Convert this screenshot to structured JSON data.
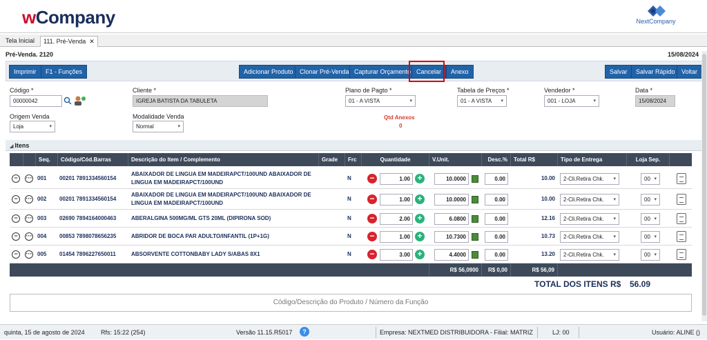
{
  "header": {
    "brand_w": "w",
    "brand_rest": "Company",
    "partner": "NextCompany"
  },
  "tabs": [
    {
      "label": "Tela Inicial"
    },
    {
      "label": "111. Pré-Venda",
      "close": "✕"
    }
  ],
  "page": {
    "title": "Pré-Venda. 2120",
    "date": "15/08/2024"
  },
  "toolbar": {
    "imprimir": "Imprimir",
    "f1": "F1 - Funções",
    "adicionar": "Adicionar Produto",
    "clonar": "Clonar Pré-Venda",
    "capturar": "Capturar Orçamento",
    "cancelar": "Cancelar",
    "anexo": "Anexo",
    "salvar": "Salvar",
    "salvar_rapido": "Salvar Rápido",
    "voltar": "Voltar"
  },
  "form": {
    "codigo_label": "Código *",
    "codigo": "00000042",
    "cliente_label": "Cliente *",
    "cliente": "IGREJA BATISTA DA TABULETA",
    "plano_label": "Plano de Pagto *",
    "plano": "01 - A VISTA",
    "tabela_label": "Tabela de Preços *",
    "tabela": "01 - A VISTA",
    "vendedor_label": "Vendedor *",
    "vendedor": "001 - LOJA",
    "data_label": "Data *",
    "data": "15/08/2024",
    "origem_label": "Origem Venda",
    "origem": "Loja",
    "modalidade_label": "Modalidade Venda",
    "modalidade": "Normal",
    "qtd_anexos_label": "Qtd Anexos",
    "qtd_anexos": "0"
  },
  "items_section": {
    "label": "Itens"
  },
  "columns": {
    "seq": "Seq.",
    "codigo": "Código/Cód.Barras",
    "descricao": "Descrição do Item / Complemento",
    "grade": "Grade",
    "frc": "Frc",
    "quantidade": "Quantidade",
    "vunit": "V.Unit.",
    "desc": "Desc.%",
    "total": "Total R$",
    "entrega": "Tipo de Entrega",
    "loja": "Loja Sep."
  },
  "rows": [
    {
      "seq": "001",
      "codigo": "00201 7891334560154",
      "desc_line1": "ABAIXADOR DE LINGUA EM MADEIRAPCT/100UND ABAIXADOR DE",
      "desc_line2": "LINGUA EM MADEIRAPCT/100UND",
      "frc": "N",
      "qty": "1.00",
      "vunit": "10.0000",
      "descp": "0.00",
      "total": "10.00",
      "entrega": "2-Cli.Retira Chk.",
      "loja": "00"
    },
    {
      "seq": "002",
      "codigo": "00201 7891334560154",
      "desc_line1": "ABAIXADOR DE LINGUA EM MADEIRAPCT/100UND ABAIXADOR DE",
      "desc_line2": "LINGUA EM MADEIRAPCT/100UND",
      "frc": "N",
      "qty": "1.00",
      "vunit": "10.0000",
      "descp": "0.00",
      "total": "10.00",
      "entrega": "2-Cli.Retira Chk.",
      "loja": "00"
    },
    {
      "seq": "003",
      "codigo": "02690 7894164000463",
      "desc_line1": "ABERALGINA 500MG/ML GTS 20ML (DIPIRONA SOD)",
      "desc_line2": "",
      "frc": "N",
      "qty": "2.00",
      "vunit": "6.0800",
      "descp": "0.00",
      "total": "12.16",
      "entrega": "2-Cli.Retira Chk.",
      "loja": "00"
    },
    {
      "seq": "004",
      "codigo": "00853 7898078656235",
      "desc_line1": "ABRIDOR DE BOCA PAR ADULTO/INFANTIL (1P+1G)",
      "desc_line2": "",
      "frc": "N",
      "qty": "1.00",
      "vunit": "10.7300",
      "descp": "0.00",
      "total": "10.73",
      "entrega": "2-Cli.Retira Chk.",
      "loja": "00"
    },
    {
      "seq": "005",
      "codigo": "01454 7896227650011",
      "desc_line1": "ABSORVENTE COTTONBABY LADY S/ABAS 8X1",
      "desc_line2": "",
      "frc": "N",
      "qty": "3.00",
      "vunit": "4.4000",
      "descp": "0.00",
      "total": "13.20",
      "entrega": "2-Cli.Retira Chk.",
      "loja": "00"
    }
  ],
  "footer": {
    "vunit_sum": "R$ 56,0900",
    "desc_sum": "R$ 0,00",
    "total_sum": "R$ 56,09",
    "total_label": "TOTAL DOS ITENS R$",
    "total_value": "56.09"
  },
  "search": {
    "placeholder": "Código/Descrição do Produto / Número da Função"
  },
  "status": {
    "date": "quinta, 15 de agosto de 2024",
    "rfs": "Rfs: 15:22 (254)",
    "version": "Versão 11.15.R5017",
    "help": "?",
    "empresa": "Empresa: NEXTMED DISTRIBUIDORA - Filial: MATRIZ",
    "lj": "LJ: 00",
    "usuario": "Usuário: ALINE ()"
  }
}
